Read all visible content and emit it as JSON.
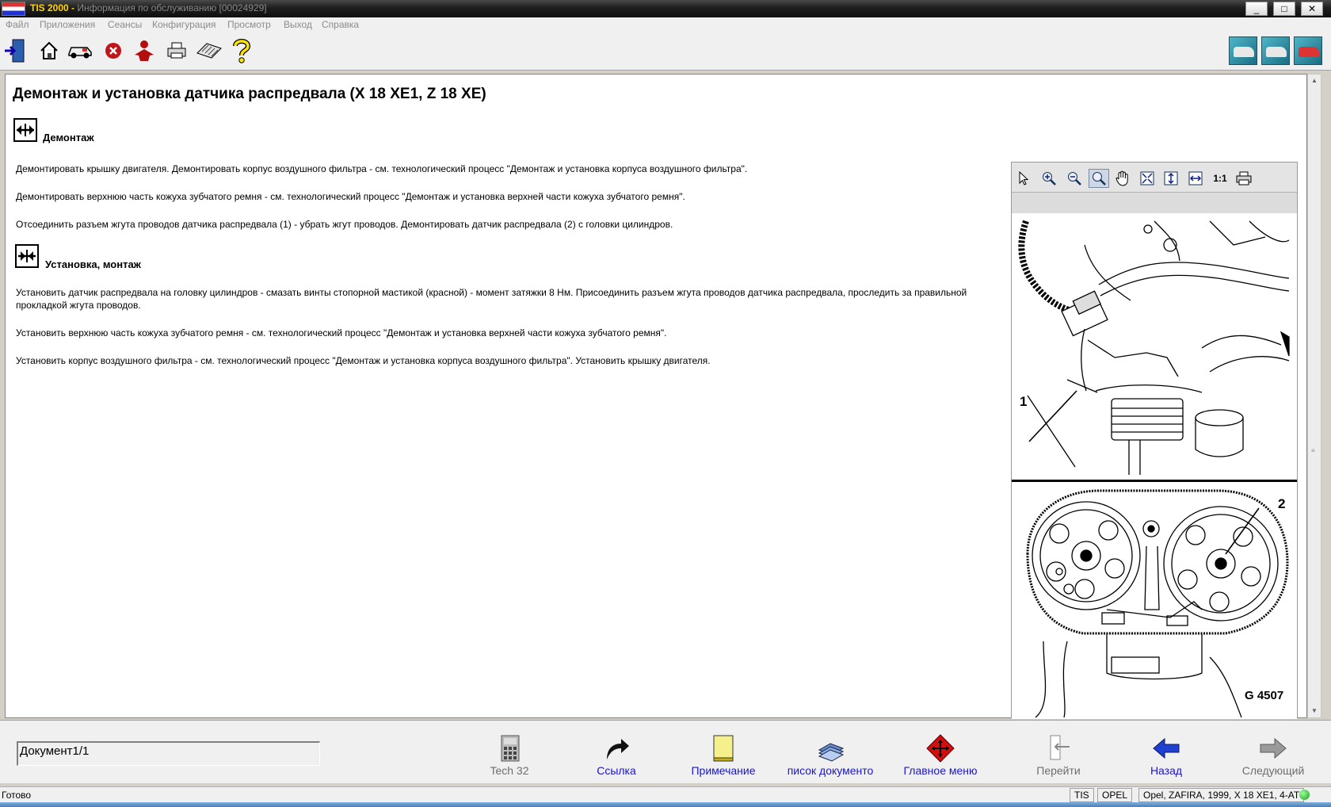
{
  "window": {
    "app_name": "TIS 2000 -",
    "subtitle": "Информация по обслуживанию [00024929]",
    "controls": [
      "_",
      "□",
      "✕"
    ]
  },
  "menu": [
    "Файл",
    "Приложения",
    "Сеансы",
    "Конфигурация",
    "Просмотр",
    "Выход",
    "Справка"
  ],
  "toolbar": {
    "left_icons": [
      "exit-icon",
      "home-icon",
      "vehicle-icon",
      "stop-icon",
      "person-icon",
      "print-icon",
      "keyboard-icon",
      "help-icon"
    ],
    "right_icons": [
      "vehicle-service-icon",
      "vehicle-diagnosis-icon",
      "vehicle-repair-icon"
    ]
  },
  "document": {
    "title": "Демонтаж и установка датчика распредвала (X 18 XE1, Z 18 XE)",
    "section_removal": "Демонтаж",
    "removal_steps": [
      "Демонтировать крышку двигателя. Демонтировать корпус воздушного фильтра - см. технологический процесс \"Демонтаж и установка корпуса воздушного фильтра\".",
      "Демонтировать верхнюю часть кожуха зубчатого ремня - см. технологический процесс \"Демонтаж и установка верхней части кожуха зубчатого ремня\".",
      "Отсоединить разъем жгута проводов датчика распредвала (1) - убрать жгут проводов. Демонтировать датчик распредвала (2) с головки цилиндров."
    ],
    "section_install": "Установка, монтаж",
    "install_steps": [
      "Установить датчик распредвала на головку цилиндров - смазать винты стопорной мастикой (красной) - момент затяжки 8 Нм. Присоединить разъем жгута проводов датчика распредвала, проследить за правильной прокладкой жгута проводов.",
      "Установить верхнюю часть кожуха зубчатого ремня - см. технологический процесс \"Демонтаж и установка верхней части кожуха зубчатого ремня\".",
      "Установить корпус воздушного фильтра - см. технологический процесс \"Демонтаж и установка корпуса воздушного фильтра\". Установить крышку двигателя."
    ]
  },
  "viewer": {
    "tools": [
      "pointer-icon",
      "zoom-in-icon",
      "zoom-out-icon",
      "zoom-window-icon",
      "pan-hand-icon",
      "fit-page-icon",
      "fit-height-icon",
      "fit-width-icon"
    ],
    "actual_size_label": "1:1",
    "figure_labels": [
      "1",
      "2"
    ],
    "figure_code": "G 4507"
  },
  "bottom": {
    "document_field": "Документ1/1",
    "nav": [
      {
        "label": "Tech 32",
        "enabled": false
      },
      {
        "label": "Ссылка",
        "enabled": true
      },
      {
        "label": "Примечание",
        "enabled": true
      },
      {
        "label": "писок документо",
        "enabled": true
      },
      {
        "label": "Главное меню",
        "enabled": true
      },
      {
        "label": "Перейти",
        "enabled": false
      },
      {
        "label": "Назад",
        "enabled": true
      },
      {
        "label": "Следующий",
        "enabled": false
      }
    ]
  },
  "status": {
    "text": "Готово",
    "cells": [
      "TIS",
      "OPEL",
      "Opel, ZAFIRA, 1999, X 18 XE1, 4-AT"
    ]
  }
}
